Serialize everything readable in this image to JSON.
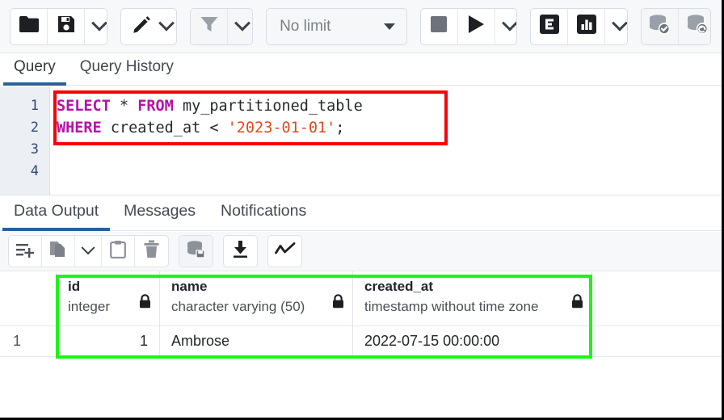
{
  "app": {
    "name": "pgAdmin Query Tool"
  },
  "toolbar": {
    "groups": [
      {
        "name": "file-group",
        "buttons": [
          {
            "name": "open-file-button",
            "icon": "folder-icon",
            "label": "Open File"
          },
          {
            "name": "save-file-button",
            "icon": "save-icon",
            "label": "Save File"
          },
          {
            "name": "save-file-dropdown",
            "icon": "chevron-down-icon",
            "label": "Save options"
          }
        ]
      },
      {
        "name": "edit-group",
        "buttons": [
          {
            "name": "edit-button",
            "icon": "pencil-icon",
            "label": "Edit"
          },
          {
            "name": "edit-dropdown",
            "icon": "chevron-down-icon",
            "label": "Edit options"
          }
        ]
      },
      {
        "name": "filter-group",
        "buttons": [
          {
            "name": "filter-button",
            "icon": "funnel-icon",
            "label": "Filter"
          },
          {
            "name": "filter-dropdown",
            "icon": "chevron-down-icon",
            "label": "Filter options"
          }
        ]
      },
      {
        "name": "execute-group",
        "buttons": [
          {
            "name": "stop-button",
            "icon": "stop-square-icon",
            "label": "Stop"
          },
          {
            "name": "execute-button",
            "icon": "play-icon",
            "label": "Execute"
          },
          {
            "name": "execute-dropdown",
            "icon": "chevron-down-icon",
            "label": "Execute options"
          }
        ]
      },
      {
        "name": "analysis-group",
        "buttons": [
          {
            "name": "explain-button",
            "icon": "explain-e-icon",
            "label": "Explain"
          },
          {
            "name": "analyze-button",
            "icon": "bar-chart-icon",
            "label": "Explain Analyze"
          },
          {
            "name": "analysis-dropdown",
            "icon": "chevron-down-icon",
            "label": "Explain options"
          }
        ]
      },
      {
        "name": "transaction-group",
        "buttons": [
          {
            "name": "commit-button",
            "icon": "database-check-icon",
            "label": "Commit"
          },
          {
            "name": "rollback-button",
            "icon": "database-rollback-icon",
            "label": "Rollback"
          }
        ]
      }
    ],
    "limit": {
      "value": "No limit",
      "caret": "caret-down-icon"
    }
  },
  "query_tabs": {
    "active": "Query",
    "items": [
      {
        "name": "tab-query",
        "label": "Query"
      },
      {
        "name": "tab-query-history",
        "label": "Query History"
      }
    ]
  },
  "editor": {
    "line_numbers": [
      "1",
      "2",
      "3",
      "4"
    ],
    "sql": {
      "line1": {
        "kw_select": "SELECT",
        "star": " * ",
        "kw_from": "FROM",
        "table": " my_partitioned_table"
      },
      "line2": {
        "kw_where": "WHERE",
        "column": " created_at < ",
        "literal": "'2023-01-01'",
        "semicolon": ";"
      }
    },
    "highlight_color": "#fb0007"
  },
  "output_tabs": {
    "active": "Data Output",
    "items": [
      {
        "name": "tab-data-output",
        "label": "Data Output"
      },
      {
        "name": "tab-messages",
        "label": "Messages"
      },
      {
        "name": "tab-notifications",
        "label": "Notifications"
      }
    ]
  },
  "result_toolbar": {
    "buttons": [
      {
        "name": "add-row-button",
        "icon": "add-row-icon",
        "label": "Add row"
      },
      {
        "name": "copy-button",
        "icon": "copy-icon",
        "label": "Copy"
      },
      {
        "name": "copy-dropdown",
        "icon": "chevron-down-icon",
        "label": "Copy options"
      },
      {
        "name": "paste-button",
        "icon": "clipboard-icon",
        "label": "Paste"
      },
      {
        "name": "delete-button",
        "icon": "trash-icon",
        "label": "Delete"
      },
      {
        "name": "save-data-button",
        "icon": "database-save-icon",
        "label": "Save Data Changes"
      },
      {
        "name": "download-csv-button",
        "icon": "download-icon",
        "label": "Download as CSV"
      },
      {
        "name": "graph-visualiser-button",
        "icon": "line-chart-icon",
        "label": "Graph Visualiser"
      }
    ]
  },
  "grid": {
    "highlight_color": "#1cf518",
    "columns": [
      {
        "name": "id",
        "type": "integer",
        "lock": "lock-icon"
      },
      {
        "name": "name",
        "type": "character varying (50)",
        "lock": "lock-icon"
      },
      {
        "name": "created_at",
        "type": "timestamp without time zone",
        "lock": "lock-icon"
      }
    ],
    "rows": [
      {
        "rownum": "1",
        "id": "1",
        "name": "Ambrose",
        "created_at": "2022-07-15 00:00:00"
      }
    ]
  }
}
